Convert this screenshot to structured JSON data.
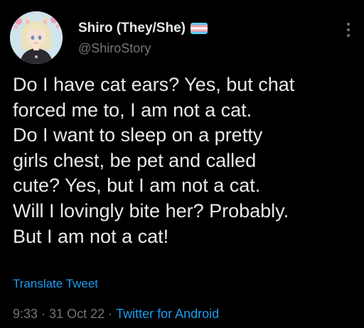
{
  "author": {
    "display_name": "Shiro (They/She)",
    "handle": "@ShiroStory",
    "flag_icon": "transgender-flag-icon",
    "avatar": "avatar-anime-cat-ears"
  },
  "tweet": {
    "text": "Do I have cat ears? Yes, but chat\nforced me to, I am not a cat.\nDo I want to sleep on a pretty\ngirls chest, be pet and called\ncute? Yes, but I am not a cat.\nWill I lovingly bite her? Probably.\nBut I am not a cat!",
    "translate_label": "Translate Tweet",
    "time": "9:33",
    "date": "31 Oct 22",
    "separator": "·",
    "source": "Twitter for Android"
  },
  "colors": {
    "background": "#000000",
    "text": "#e7e9ea",
    "secondary": "#71767b",
    "link": "#1d9bf0",
    "flag_blue": "#5bcefa",
    "flag_pink": "#f5a9b8",
    "flag_white": "#ffffff"
  }
}
